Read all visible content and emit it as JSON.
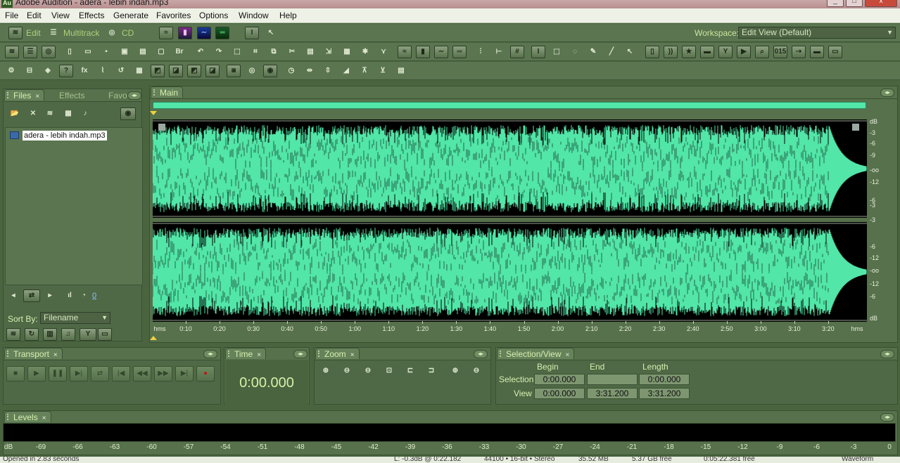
{
  "window": {
    "title": "Adobe Audition - adera - lebih indah.mp3",
    "app_badge": "Au"
  },
  "menu": [
    "File",
    "Edit",
    "View",
    "Effects",
    "Generate",
    "Favorites",
    "Options",
    "Window",
    "Help"
  ],
  "modes": {
    "edit": "Edit",
    "multitrack": "Multitrack",
    "cd": "CD"
  },
  "workspace": {
    "label": "Workspace:",
    "value": "Edit View (Default)"
  },
  "files_panel": {
    "tabs": [
      "Files",
      "Effects",
      "Favo"
    ],
    "file": "adera - lebih indah.mp3",
    "level_value": "0",
    "sort_label": "Sort By:",
    "sort_value": "Filename"
  },
  "editor": {
    "tab": "Main",
    "db_labels": [
      "dB",
      "-3",
      "-6",
      "-9",
      "-oo",
      "-12",
      "-6",
      "-3",
      "-3",
      "-6",
      "-12",
      "-oo",
      "-12",
      "-6",
      "dB"
    ],
    "time_labels": [
      "hms",
      "0:10",
      "0:20",
      "0:30",
      "0:40",
      "0:50",
      "1:00",
      "1:10",
      "1:20",
      "1:30",
      "1:40",
      "1:50",
      "2:00",
      "2:10",
      "2:20",
      "2:30",
      "2:40",
      "2:50",
      "3:00",
      "3:10",
      "3:20",
      "hms"
    ]
  },
  "transport": {
    "tab": "Transport"
  },
  "time_panel": {
    "tab": "Time",
    "value": "0:00.000"
  },
  "zoom_panel": {
    "tab": "Zoom"
  },
  "selection_view": {
    "tab": "Selection/View",
    "headers": [
      "Begin",
      "End",
      "Length"
    ],
    "selection": {
      "label": "Selection",
      "begin": "0:00.000",
      "end": "",
      "length": "0:00.000"
    },
    "view": {
      "label": "View",
      "begin": "0:00.000",
      "end": "3:31.200",
      "length": "3:31.200"
    }
  },
  "levels": {
    "tab": "Levels",
    "scale": [
      "dB",
      "-69",
      "-66",
      "-63",
      "-60",
      "-57",
      "-54",
      "-51",
      "-48",
      "-45",
      "-42",
      "-39",
      "-36",
      "-33",
      "-30",
      "-27",
      "-24",
      "-21",
      "-18",
      "-15",
      "-12",
      "-9",
      "-6",
      "-3",
      "0"
    ]
  },
  "status": {
    "left": "Opened in 2.83 seconds",
    "level": "L: -0.3dB @ 0:22.182",
    "format": "44100 • 16-bit • Stereo",
    "size": "35.52 MB",
    "free": "5.37 GB free",
    "duration": "0:05:22.381 free",
    "view": "Waveform"
  },
  "colors": {
    "waveform": "#52e6a8",
    "background": "#4a6440",
    "accent_text": "#d7f0a8"
  }
}
